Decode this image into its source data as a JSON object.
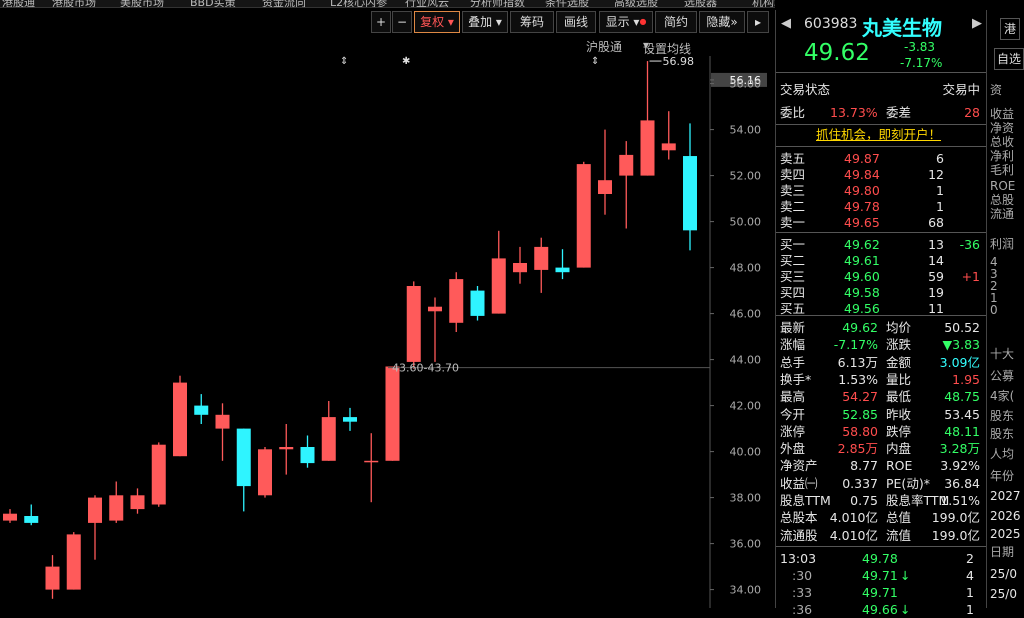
{
  "menu": [
    "港股通",
    "港股市场",
    "美股市场",
    "BBD买策",
    "资金流向",
    "L2核心内参",
    "行业风云",
    "分析师指数",
    "条件选股",
    "高级选股",
    "选股器",
    "机构增仓",
    "热点直击",
    "高端决策",
    "机构推荐"
  ],
  "toolbar": {
    "zoom_in": "+",
    "zoom_out": "−",
    "fuquan": "复权",
    "diejia": "叠加",
    "chouma": "筹码",
    "huaxian": "画线",
    "xianshi": "显示",
    "jianyue": "简约",
    "yincang": "隐藏"
  },
  "subbar": {
    "hugutong": "沪股通",
    "shezhi": "设置均线",
    "marks": [
      "⇕",
      "✱",
      "⇕"
    ]
  },
  "chart_data": {
    "type": "candlestick",
    "ylim": [
      33.2,
      57.2
    ],
    "yticks": [
      "56.16",
      "56.00",
      "54.00",
      "52.00",
      "50.00",
      "48.00",
      "46.00",
      "44.00",
      "42.00",
      "40.00",
      "38.00",
      "36.00",
      "34.00"
    ],
    "candles": [
      {
        "o": 37.0,
        "c": 37.3,
        "h": 37.5,
        "l": 36.9
      },
      {
        "o": 37.2,
        "c": 36.9,
        "h": 37.7,
        "l": 36.8
      },
      {
        "o": 34.0,
        "c": 35.0,
        "h": 35.5,
        "l": 33.6
      },
      {
        "o": 34.0,
        "c": 36.4,
        "h": 36.5,
        "l": 34.0
      },
      {
        "o": 36.9,
        "c": 38.0,
        "h": 38.1,
        "l": 35.3
      },
      {
        "o": 37.0,
        "c": 38.1,
        "h": 38.7,
        "l": 36.9
      },
      {
        "o": 37.5,
        "c": 38.1,
        "h": 38.4,
        "l": 37.3
      },
      {
        "o": 37.7,
        "c": 40.3,
        "h": 40.4,
        "l": 37.6
      },
      {
        "o": 39.8,
        "c": 43.0,
        "h": 43.3,
        "l": 39.8
      },
      {
        "o": 42.0,
        "c": 41.6,
        "h": 42.5,
        "l": 41.2
      },
      {
        "o": 41.0,
        "c": 41.6,
        "h": 42.1,
        "l": 39.6
      },
      {
        "o": 41.0,
        "c": 38.5,
        "h": 41.0,
        "l": 37.4
      },
      {
        "o": 38.1,
        "c": 40.1,
        "h": 40.2,
        "l": 38.0
      },
      {
        "o": 40.1,
        "c": 40.2,
        "h": 41.2,
        "l": 39.0
      },
      {
        "o": 40.2,
        "c": 39.5,
        "h": 40.7,
        "l": 39.3
      },
      {
        "o": 39.6,
        "c": 41.5,
        "h": 42.2,
        "l": 39.6
      },
      {
        "o": 41.5,
        "c": 41.3,
        "h": 41.9,
        "l": 40.9
      },
      {
        "o": 39.6,
        "c": 39.6,
        "h": 40.8,
        "l": 37.8
      },
      {
        "o": 39.6,
        "c": 43.7,
        "h": 43.7,
        "l": 39.6
      },
      {
        "o": 43.9,
        "c": 47.2,
        "h": 47.4,
        "l": 43.6
      },
      {
        "o": 46.1,
        "c": 46.3,
        "h": 46.7,
        "l": 43.9
      },
      {
        "o": 45.6,
        "c": 47.5,
        "h": 47.8,
        "l": 45.2
      },
      {
        "o": 47.0,
        "c": 45.9,
        "h": 47.2,
        "l": 45.7
      },
      {
        "o": 46.0,
        "c": 48.4,
        "h": 49.6,
        "l": 46.0
      },
      {
        "o": 47.8,
        "c": 48.2,
        "h": 48.9,
        "l": 47.3
      },
      {
        "o": 47.9,
        "c": 48.9,
        "h": 49.3,
        "l": 46.9
      },
      {
        "o": 48.0,
        "c": 47.8,
        "h": 48.8,
        "l": 47.5
      },
      {
        "o": 48.0,
        "c": 52.5,
        "h": 52.6,
        "l": 48.0
      },
      {
        "o": 51.2,
        "c": 51.8,
        "h": 54.0,
        "l": 50.3
      },
      {
        "o": 52.0,
        "c": 52.9,
        "h": 53.5,
        "l": 49.7
      },
      {
        "o": 52.0,
        "c": 54.4,
        "h": 56.98,
        "l": 52.0
      },
      {
        "o": 53.1,
        "c": 53.4,
        "h": 54.8,
        "l": 52.7
      },
      {
        "o": 52.85,
        "c": 49.62,
        "h": 54.27,
        "l": 48.75
      }
    ],
    "annotations": {
      "max_label": "56.98",
      "price_line_label": "43.60-43.70"
    }
  },
  "quote": {
    "code": "603983",
    "name": "丸美生物",
    "price": "49.62",
    "change": "-3.83",
    "pct": "-7.17%",
    "tag1": "港",
    "tag2": "自选",
    "status_label": "交易状态",
    "status_value": "交易中",
    "weibi_label": "委比",
    "weibi_value": "13.73%",
    "weicha_label": "委差",
    "weicha_value": "28",
    "promo": "抓住机会，即刻开户！",
    "sells": [
      {
        "label": "卖五",
        "price": "49.87",
        "vol": "6"
      },
      {
        "label": "卖四",
        "price": "49.84",
        "vol": "12"
      },
      {
        "label": "卖三",
        "price": "49.80",
        "vol": "1"
      },
      {
        "label": "卖二",
        "price": "49.78",
        "vol": "1"
      },
      {
        "label": "卖一",
        "price": "49.65",
        "vol": "68"
      }
    ],
    "buys": [
      {
        "label": "买一",
        "price": "49.62",
        "vol": "13",
        "chg": "-36"
      },
      {
        "label": "买二",
        "price": "49.61",
        "vol": "14",
        "chg": ""
      },
      {
        "label": "买三",
        "price": "49.60",
        "vol": "59",
        "chg": "+1"
      },
      {
        "label": "买四",
        "price": "49.58",
        "vol": "19",
        "chg": ""
      },
      {
        "label": "买五",
        "price": "49.56",
        "vol": "11",
        "chg": ""
      }
    ],
    "stats": [
      [
        "最新",
        "49.62",
        "均价",
        "50.52"
      ],
      [
        "涨幅",
        "-7.17%",
        "涨跌",
        "▼3.83"
      ],
      [
        "总手",
        "6.13万",
        "金额",
        "3.09亿"
      ],
      [
        "换手*",
        "1.53%",
        "量比",
        "1.95"
      ],
      [
        "最高",
        "54.27",
        "最低",
        "48.75"
      ],
      [
        "今开",
        "52.85",
        "昨收",
        "53.45"
      ],
      [
        "涨停",
        "58.80",
        "跌停",
        "48.11"
      ],
      [
        "外盘",
        "2.85万",
        "内盘",
        "3.28万"
      ],
      [
        "净资产",
        "8.77",
        "ROE",
        "3.92%"
      ],
      [
        "收益㈠",
        "0.337",
        "PE(动)*",
        "36.84"
      ],
      [
        "股息TTM",
        "0.75",
        "股息率TTM",
        "1.51%"
      ],
      [
        "总股本",
        "4.010亿",
        "总值",
        "199.0亿"
      ],
      [
        "流通股",
        "4.010亿",
        "流值",
        "199.0亿"
      ]
    ],
    "ticks": [
      {
        "time": "13:03",
        "price": "49.78",
        "arrow": "",
        "vol": "2"
      },
      {
        "time": ":30",
        "price": "49.71",
        "arrow": "↓",
        "vol": "4"
      },
      {
        "time": ":33",
        "price": "49.71",
        "arrow": "",
        "vol": "1"
      },
      {
        "time": ":36",
        "price": "49.66",
        "arrow": "↓",
        "vol": "1"
      }
    ]
  },
  "far": {
    "items": [
      "资",
      "收益",
      "净资",
      "总收",
      "净利",
      "毛利",
      "ROE",
      "总股",
      "流通",
      "利润",
      "4",
      "3",
      "2",
      "1",
      "0",
      "十大",
      "公募",
      "4家(",
      "股东",
      "股东",
      "人均",
      "年份",
      "2027",
      "2026",
      "2025",
      "日期",
      "25/0",
      "25/0",
      "25/0"
    ]
  }
}
